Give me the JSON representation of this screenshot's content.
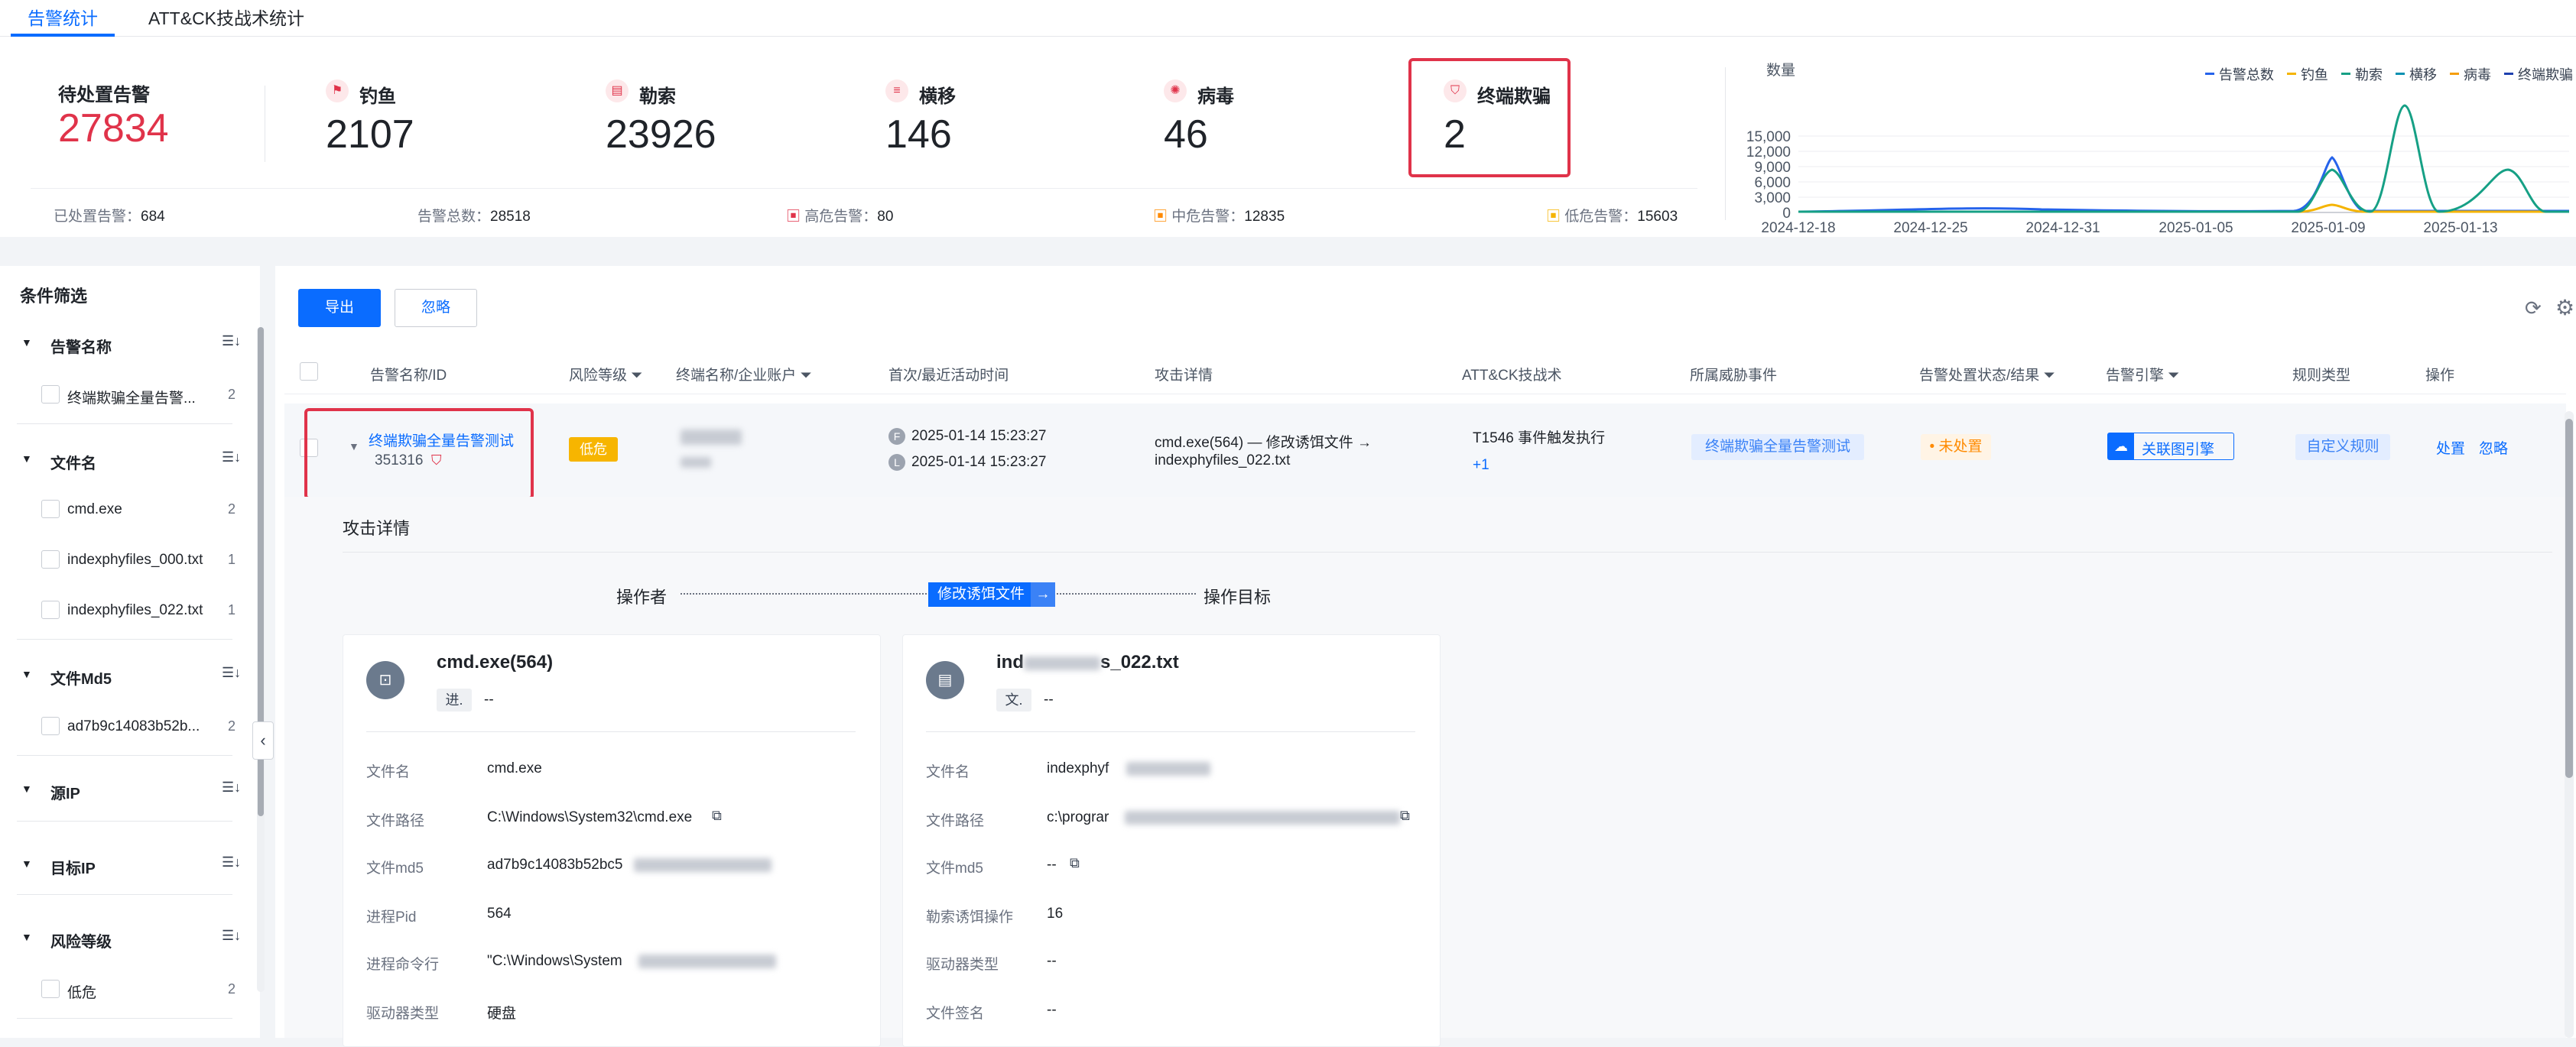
{
  "tabs": [
    {
      "label": "告警统计"
    },
    {
      "label": "ATT&CK技战术统计"
    }
  ],
  "pending": {
    "label": "待处置告警",
    "value": "27834"
  },
  "categories": [
    {
      "label": "钓鱼",
      "value": "2107",
      "icon": "fish-hook-icon"
    },
    {
      "label": "勒索",
      "value": "23926",
      "icon": "lock-icon"
    },
    {
      "label": "横移",
      "value": "146",
      "icon": "lateral-move-icon"
    },
    {
      "label": "病毒",
      "value": "46",
      "icon": "virus-icon"
    },
    {
      "label": "终端欺骗",
      "value": "2",
      "icon": "shield-icon"
    }
  ],
  "summary": {
    "handled": {
      "label": "已处置告警：",
      "value": "684"
    },
    "total": {
      "label": "告警总数：",
      "value": "28518"
    },
    "high": {
      "label": "高危告警：",
      "value": "80"
    },
    "mid": {
      "label": "中危告警：",
      "value": "12835"
    },
    "low": {
      "label": "低危告警：",
      "value": "15603"
    }
  },
  "chart_data": {
    "type": "line",
    "ylabel": "数量",
    "ylim": [
      0,
      15000
    ],
    "yticks": [
      "15,000",
      "12,000",
      "9,000",
      "6,000",
      "3,000",
      "0"
    ],
    "xticks": [
      "2024-12-18",
      "2024-12-25",
      "2024-12-31",
      "2025-01-05",
      "2025-01-09",
      "2025-01-13"
    ],
    "legend_position": "top-right",
    "series": [
      {
        "name": "告警总数",
        "color": "#2563eb"
      },
      {
        "name": "钓鱼",
        "color": "#f5b400"
      },
      {
        "name": "勒索",
        "color": "#16a085"
      },
      {
        "name": "横移",
        "color": "#0891b2"
      },
      {
        "name": "病毒",
        "color": "#f59e0b"
      },
      {
        "name": "终端欺骗",
        "color": "#1e40af"
      }
    ]
  },
  "sidebar": {
    "title": "条件筛选",
    "sections": [
      {
        "title": "告警名称",
        "items": [
          {
            "label": "终端欺骗全量告警...",
            "count": "2"
          }
        ]
      },
      {
        "title": "文件名",
        "items": [
          {
            "label": "cmd.exe",
            "count": "2"
          },
          {
            "label": "indexphyfiles_000.txt",
            "count": "1"
          },
          {
            "label": "indexphyfiles_022.txt",
            "count": "1"
          }
        ]
      },
      {
        "title": "文件Md5",
        "items": [
          {
            "label": "ad7b9c14083b52b...",
            "count": "2"
          }
        ]
      },
      {
        "title": "源IP",
        "items": []
      },
      {
        "title": "目标IP",
        "items": []
      },
      {
        "title": "风险等级",
        "items": [
          {
            "label": "低危",
            "count": "2"
          }
        ]
      }
    ]
  },
  "toolbar": {
    "export": "导出",
    "ignore": "忽略"
  },
  "table": {
    "headers": [
      "告警名称/ID",
      "风险等级",
      "终端名称/企业账户",
      "首次/最近活动时间",
      "攻击详情",
      "ATT&CK技战术",
      "所属威胁事件",
      "告警处置状态/结果",
      "告警引擎",
      "规则类型",
      "操作"
    ],
    "row": {
      "name": "终端欺骗全量告警测试",
      "id": "351316",
      "risk": "低危",
      "first_tag": "F",
      "first_time": "2025-01-14 15:23:27",
      "last_tag": "L",
      "last_time": "2025-01-14 15:23:27",
      "attack_line1": "cmd.exe(564) — 修改诱饵文件 →",
      "attack_line2": "indexphyfiles_022.txt",
      "attck": "T1546 事件触发执行",
      "attck_more": "+1",
      "event": "终端欺骗全量告警测试",
      "status": "未处置",
      "engine": "关联图引擎",
      "rule": "自定义规则",
      "action1": "处置",
      "action2": "忽略"
    }
  },
  "detail": {
    "title": "攻击详情",
    "actor": "操作者",
    "action": "修改诱饵文件",
    "target": "操作目标",
    "left": {
      "title": "cmd.exe(564)",
      "chip": "进.",
      "chip_value": "--",
      "rows": [
        {
          "k": "文件名",
          "v": "cmd.exe"
        },
        {
          "k": "文件路径",
          "v": "C:\\Windows\\System32\\cmd.exe"
        },
        {
          "k": "文件md5",
          "v": "ad7b9c14083b52bc5"
        },
        {
          "k": "进程Pid",
          "v": "564"
        },
        {
          "k": "进程命令行",
          "v": "\"C:\\Windows\\System"
        },
        {
          "k": "驱动器类型",
          "v": "硬盘"
        }
      ]
    },
    "right": {
      "title_a": "ind",
      "title_b": "s_022.txt",
      "chip": "文.",
      "chip_value": "--",
      "rows": [
        {
          "k": "文件名",
          "v": "indexphyf"
        },
        {
          "k": "文件路径",
          "v": "c:\\prograr"
        },
        {
          "k": "文件md5",
          "v": "--"
        },
        {
          "k": "勒索诱饵操作",
          "v": "16"
        },
        {
          "k": "驱动器类型",
          "v": "--"
        },
        {
          "k": "文件签名",
          "v": "--"
        }
      ]
    }
  }
}
